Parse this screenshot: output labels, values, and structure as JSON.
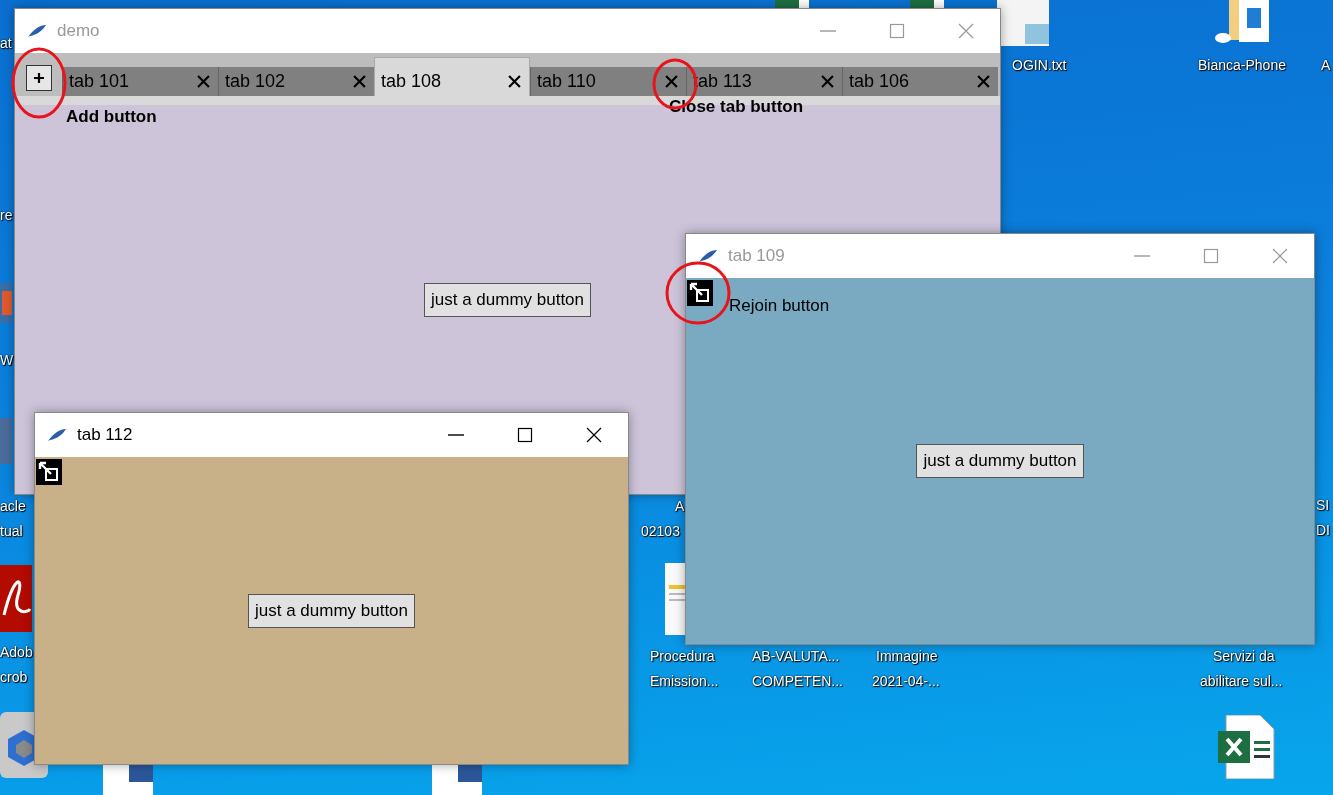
{
  "desktop": {
    "labels": [
      {
        "text": "at"
      },
      {
        "text": "re"
      },
      {
        "text": "W"
      },
      {
        "text": "acle"
      },
      {
        "text": "tual"
      },
      {
        "text": "Adob"
      },
      {
        "text": "crob"
      },
      {
        "text": "OGIN.txt"
      },
      {
        "text": "Bianca-Phone"
      },
      {
        "text": "A"
      },
      {
        "text": "A"
      },
      {
        "text": "02103"
      },
      {
        "text": "Procedura"
      },
      {
        "text": "Emission..."
      },
      {
        "text": "AB-VALUTA..."
      },
      {
        "text": "COMPETEN..."
      },
      {
        "text": "Immagine"
      },
      {
        "text": "2021-04-..."
      },
      {
        "text": "SI"
      },
      {
        "text": "DI"
      },
      {
        "text": "Servizi da"
      },
      {
        "text": "abilitare sul..."
      }
    ]
  },
  "windows": [
    {
      "kind": "tabbed",
      "title": "demo",
      "active": false,
      "color": "#cdc4da",
      "add_note": "Add button",
      "close_note": "Close tab button",
      "button": "just a dummy button",
      "tabs": [
        {
          "label": "tab 101",
          "selected": false
        },
        {
          "label": "tab 102",
          "selected": false
        },
        {
          "label": "tab 108",
          "selected": true
        },
        {
          "label": "tab 110",
          "selected": false
        },
        {
          "label": "tab 113",
          "selected": false
        },
        {
          "label": "tab 106",
          "selected": false
        }
      ]
    },
    {
      "kind": "detached",
      "title": "tab 109",
      "active": false,
      "color": "#79aac2",
      "rejoin_note": "Rejoin button",
      "button": "just a dummy button"
    },
    {
      "kind": "detached",
      "title": "tab 112",
      "active": true,
      "color": "#c8b189",
      "button": "just a dummy button"
    }
  ]
}
